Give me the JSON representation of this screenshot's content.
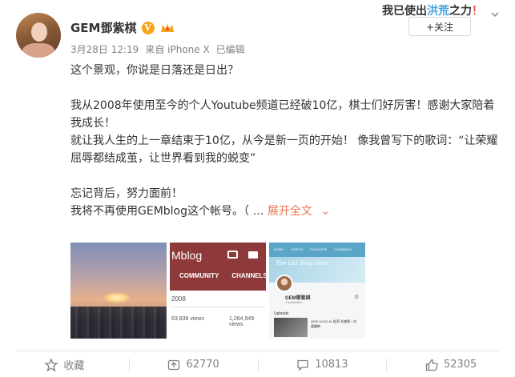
{
  "post": {
    "user": {
      "name": "GEM鄧紫棋",
      "verified_badge": "V"
    },
    "meta": {
      "date": "3月28日 12:19",
      "source": "来自 iPhone X",
      "edited": "已编辑"
    },
    "content_lines": [
      "这个景观，你说是日落还是日出？",
      "",
      "我从2008年使用至今的个人Youtube频道已经破10亿，棋士们好厉害！感谢大家陪着我成长！",
      "就让我人生的上一章结束于10亿，从今是新一页的开始！ 像我曾写下的歌词：“让荣耀屈辱都结成茧，让世界看到我的蜕变”",
      "",
      "忘记背后，努力面前！"
    ],
    "last_line": "我将不再使用GEMblog这个帐号。（ …",
    "expand_label": "展开全文",
    "expand_arrow": "⌄"
  },
  "header": {
    "banner_text_1": "我",
    "banner_text_2": "已使出",
    "banner_text_3": "洪荒",
    "banner_text_4": "之力",
    "banner_text_5": "！",
    "follow_label": "+关注"
  },
  "thumbnails": {
    "t2": {
      "title": "Mblog",
      "tab_1": "COMMUNITY",
      "tab_2": "CHANNELS",
      "year": "2008",
      "views_1": "63,836 views",
      "views_2": "1,264,949 views"
    },
    "t3": {
      "nav_1": "HOME",
      "nav_2": "VIDEOS",
      "nav_3": "PLAYLISTS",
      "nav_4": "CHANNELS",
      "script": "The Old Blog Gem",
      "channel_name": "GEM鄧紫棋",
      "subscriber": "1 subscriber",
      "uploads": "Uploads",
      "video_title": "GEM VLOG #1 批莉 杉機第一次富翻網"
    }
  },
  "footer": {
    "collect_label": "收藏",
    "repost_count": "62770",
    "comment_count": "10813",
    "like_count": "52305"
  },
  "colors": {
    "accent": "#eb7350",
    "badge": "#f6a21d",
    "muted": "#808080"
  }
}
